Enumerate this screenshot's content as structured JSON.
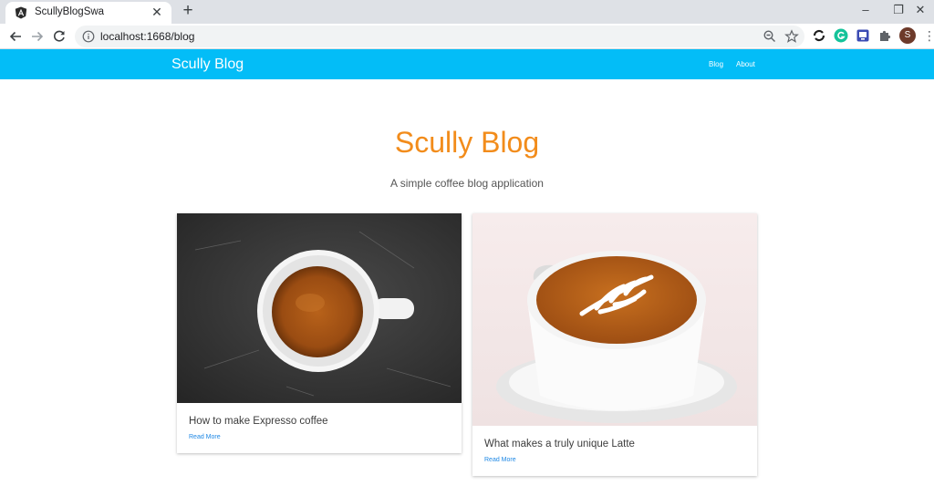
{
  "browser": {
    "tab_title": "ScullyBlogSwa",
    "tab_close": "✕",
    "new_tab": "+",
    "url": "localhost:1668/blog",
    "window_controls": {
      "minimize": "–",
      "restore": "❐",
      "close": "✕"
    },
    "profile_initial": "S",
    "extension_icons": [
      "sync-icon",
      "grammarly-icon",
      "screen-capture-icon",
      "puzzle-icon"
    ]
  },
  "header": {
    "brand": "Scully Blog",
    "nav": [
      {
        "label": "Blog"
      },
      {
        "label": "About"
      }
    ],
    "color": "#03bdf7"
  },
  "hero": {
    "title": "Scully Blog",
    "subtitle": "A simple coffee blog application",
    "title_color": "#f28c1b"
  },
  "posts": [
    {
      "title": "How to make Expresso coffee",
      "link": "Read More",
      "image": "espresso-cup-photo"
    },
    {
      "title": "What makes a truly unique Latte",
      "link": "Read More",
      "image": "latte-art-photo"
    }
  ]
}
